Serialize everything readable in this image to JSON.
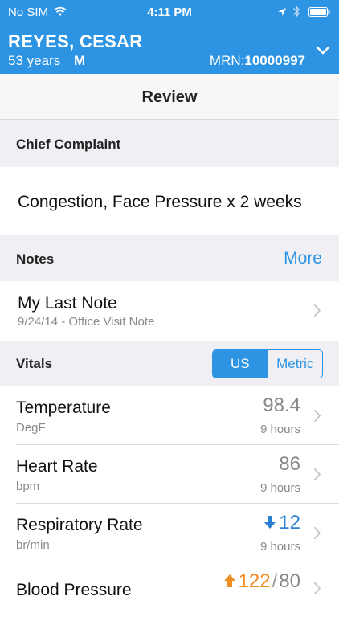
{
  "status_bar": {
    "carrier": "No SIM",
    "time": "4:11 PM"
  },
  "patient": {
    "name": "REYES, CESAR",
    "age": "53 years",
    "sex": "M",
    "mrn_label": "MRN:",
    "mrn": "10000997"
  },
  "review": {
    "title": "Review"
  },
  "chief_complaint": {
    "header": "Chief Complaint",
    "text": "Congestion, Face Pressure x 2 weeks"
  },
  "notes": {
    "header": "Notes",
    "more_label": "More",
    "last_note_title": "My Last Note",
    "last_note_subtitle": "9/24/14 - Office Visit Note"
  },
  "vitals": {
    "header": "Vitals",
    "units_toggle": [
      "US",
      "Metric"
    ],
    "selected_unit": "US",
    "items": [
      {
        "name": "Temperature",
        "unit": "DegF",
        "value": "98.4",
        "time": "9 hours",
        "trend": "none"
      },
      {
        "name": "Heart Rate",
        "unit": "bpm",
        "value": "86",
        "time": "9 hours",
        "trend": "none"
      },
      {
        "name": "Respiratory Rate",
        "unit": "br/min",
        "value": "12",
        "time": "9 hours",
        "trend": "low"
      },
      {
        "name": "Blood Pressure",
        "unit": "",
        "value": "122",
        "value_secondary": "80",
        "time": "",
        "trend": "high"
      }
    ]
  },
  "colors": {
    "accent": "#2d94e3",
    "low": "#2d7fd1",
    "high": "#ef8c22"
  }
}
